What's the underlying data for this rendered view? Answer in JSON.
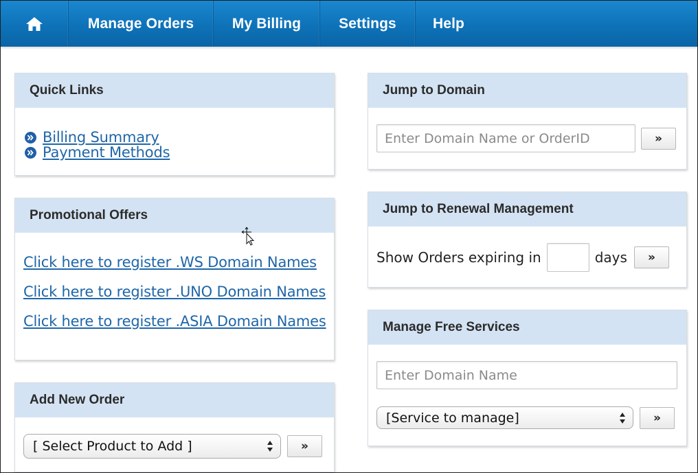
{
  "nav": {
    "home_icon": "home-icon",
    "items": [
      {
        "label": "Manage Orders"
      },
      {
        "label": "My Billing"
      },
      {
        "label": "Settings"
      },
      {
        "label": "Help"
      }
    ]
  },
  "quick_links": {
    "title": "Quick Links",
    "bullet_icon": "chevron-right-circle-icon",
    "links": [
      "Billing Summary",
      "Payment Methods"
    ]
  },
  "promotional_offers": {
    "title": "Promotional Offers",
    "links": [
      "Click here to register .WS Domain Names",
      "Click here to register .UNO Domain Names",
      "Click here to register .ASIA Domain Names"
    ]
  },
  "add_new_order": {
    "title": "Add New Order",
    "select_value": "[ Select Product to Add ]",
    "go_label": "»"
  },
  "jump_to_domain": {
    "title": "Jump to Domain",
    "placeholder": "Enter Domain Name or OrderID",
    "go_label": "»"
  },
  "jump_to_renewal": {
    "title": "Jump to Renewal Management",
    "prefix": "Show Orders expiring in",
    "days_value": "",
    "suffix": "days",
    "go_label": "»"
  },
  "manage_free_services": {
    "title": "Manage Free Services",
    "placeholder": "Enter Domain Name",
    "select_value": "[Service to manage]",
    "go_label": "»"
  },
  "colors": {
    "nav_blue": "#0e72b8",
    "panel_header": "#d4e3f3",
    "link": "#1f66a8"
  }
}
